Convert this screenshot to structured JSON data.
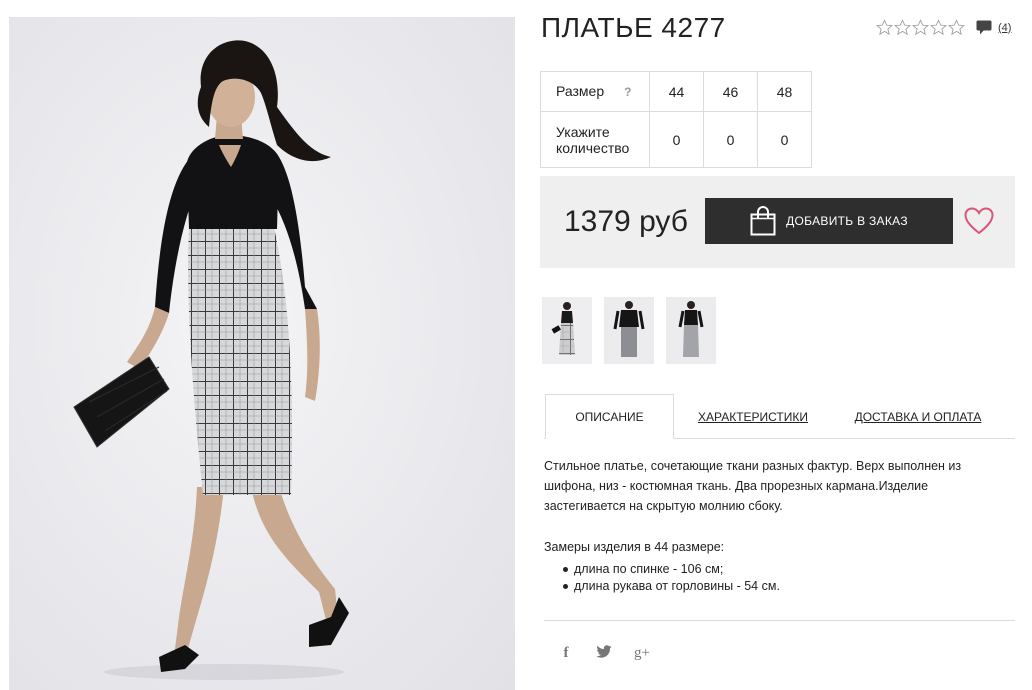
{
  "product": {
    "title": "ПЛАТЬЕ 4277",
    "rating_stars": 0,
    "rating_max": 5,
    "reviews_count": "(4)"
  },
  "sizes": {
    "size_label": "Размер",
    "help_label": "?",
    "qty_label": "Укажите количество",
    "columns": [
      "44",
      "46",
      "48"
    ],
    "quantities": [
      "0",
      "0",
      "0"
    ]
  },
  "purchase": {
    "price": "1379 руб",
    "add_button_label": "ДОБАВИТЬ В ЗАКАЗ"
  },
  "tabs": [
    {
      "label": "ОПИСАНИЕ",
      "active": true
    },
    {
      "label": "ХАРАКТЕРИСТИКИ",
      "active": false
    },
    {
      "label": "ДОСТАВКА И ОПЛАТА",
      "active": false
    }
  ],
  "description": {
    "text": "Стильное платье, сочетающие ткани разных фактур. Верх выполнен из шифона, низ - костюмная ткань. Два прорезных кармана.Изделие застегивается на скрытую молнию сбоку.",
    "measures_title": "Замеры изделия в 44 размере:",
    "measures": [
      "длина по спинке - 106 см;",
      "длина рукава от горловины - 54 см."
    ]
  },
  "social": {
    "facebook": "f",
    "twitter": "twitter-icon",
    "gplus": "g+"
  },
  "icons": [
    "star-icon",
    "comment-icon",
    "shopping-bag-icon",
    "heart-icon",
    "facebook-icon",
    "twitter-icon",
    "google-plus-icon"
  ],
  "colors": {
    "button": "#2e2e2e",
    "price_box": "#efefef",
    "heart": "#d9567a",
    "border": "#dcdcdc"
  }
}
